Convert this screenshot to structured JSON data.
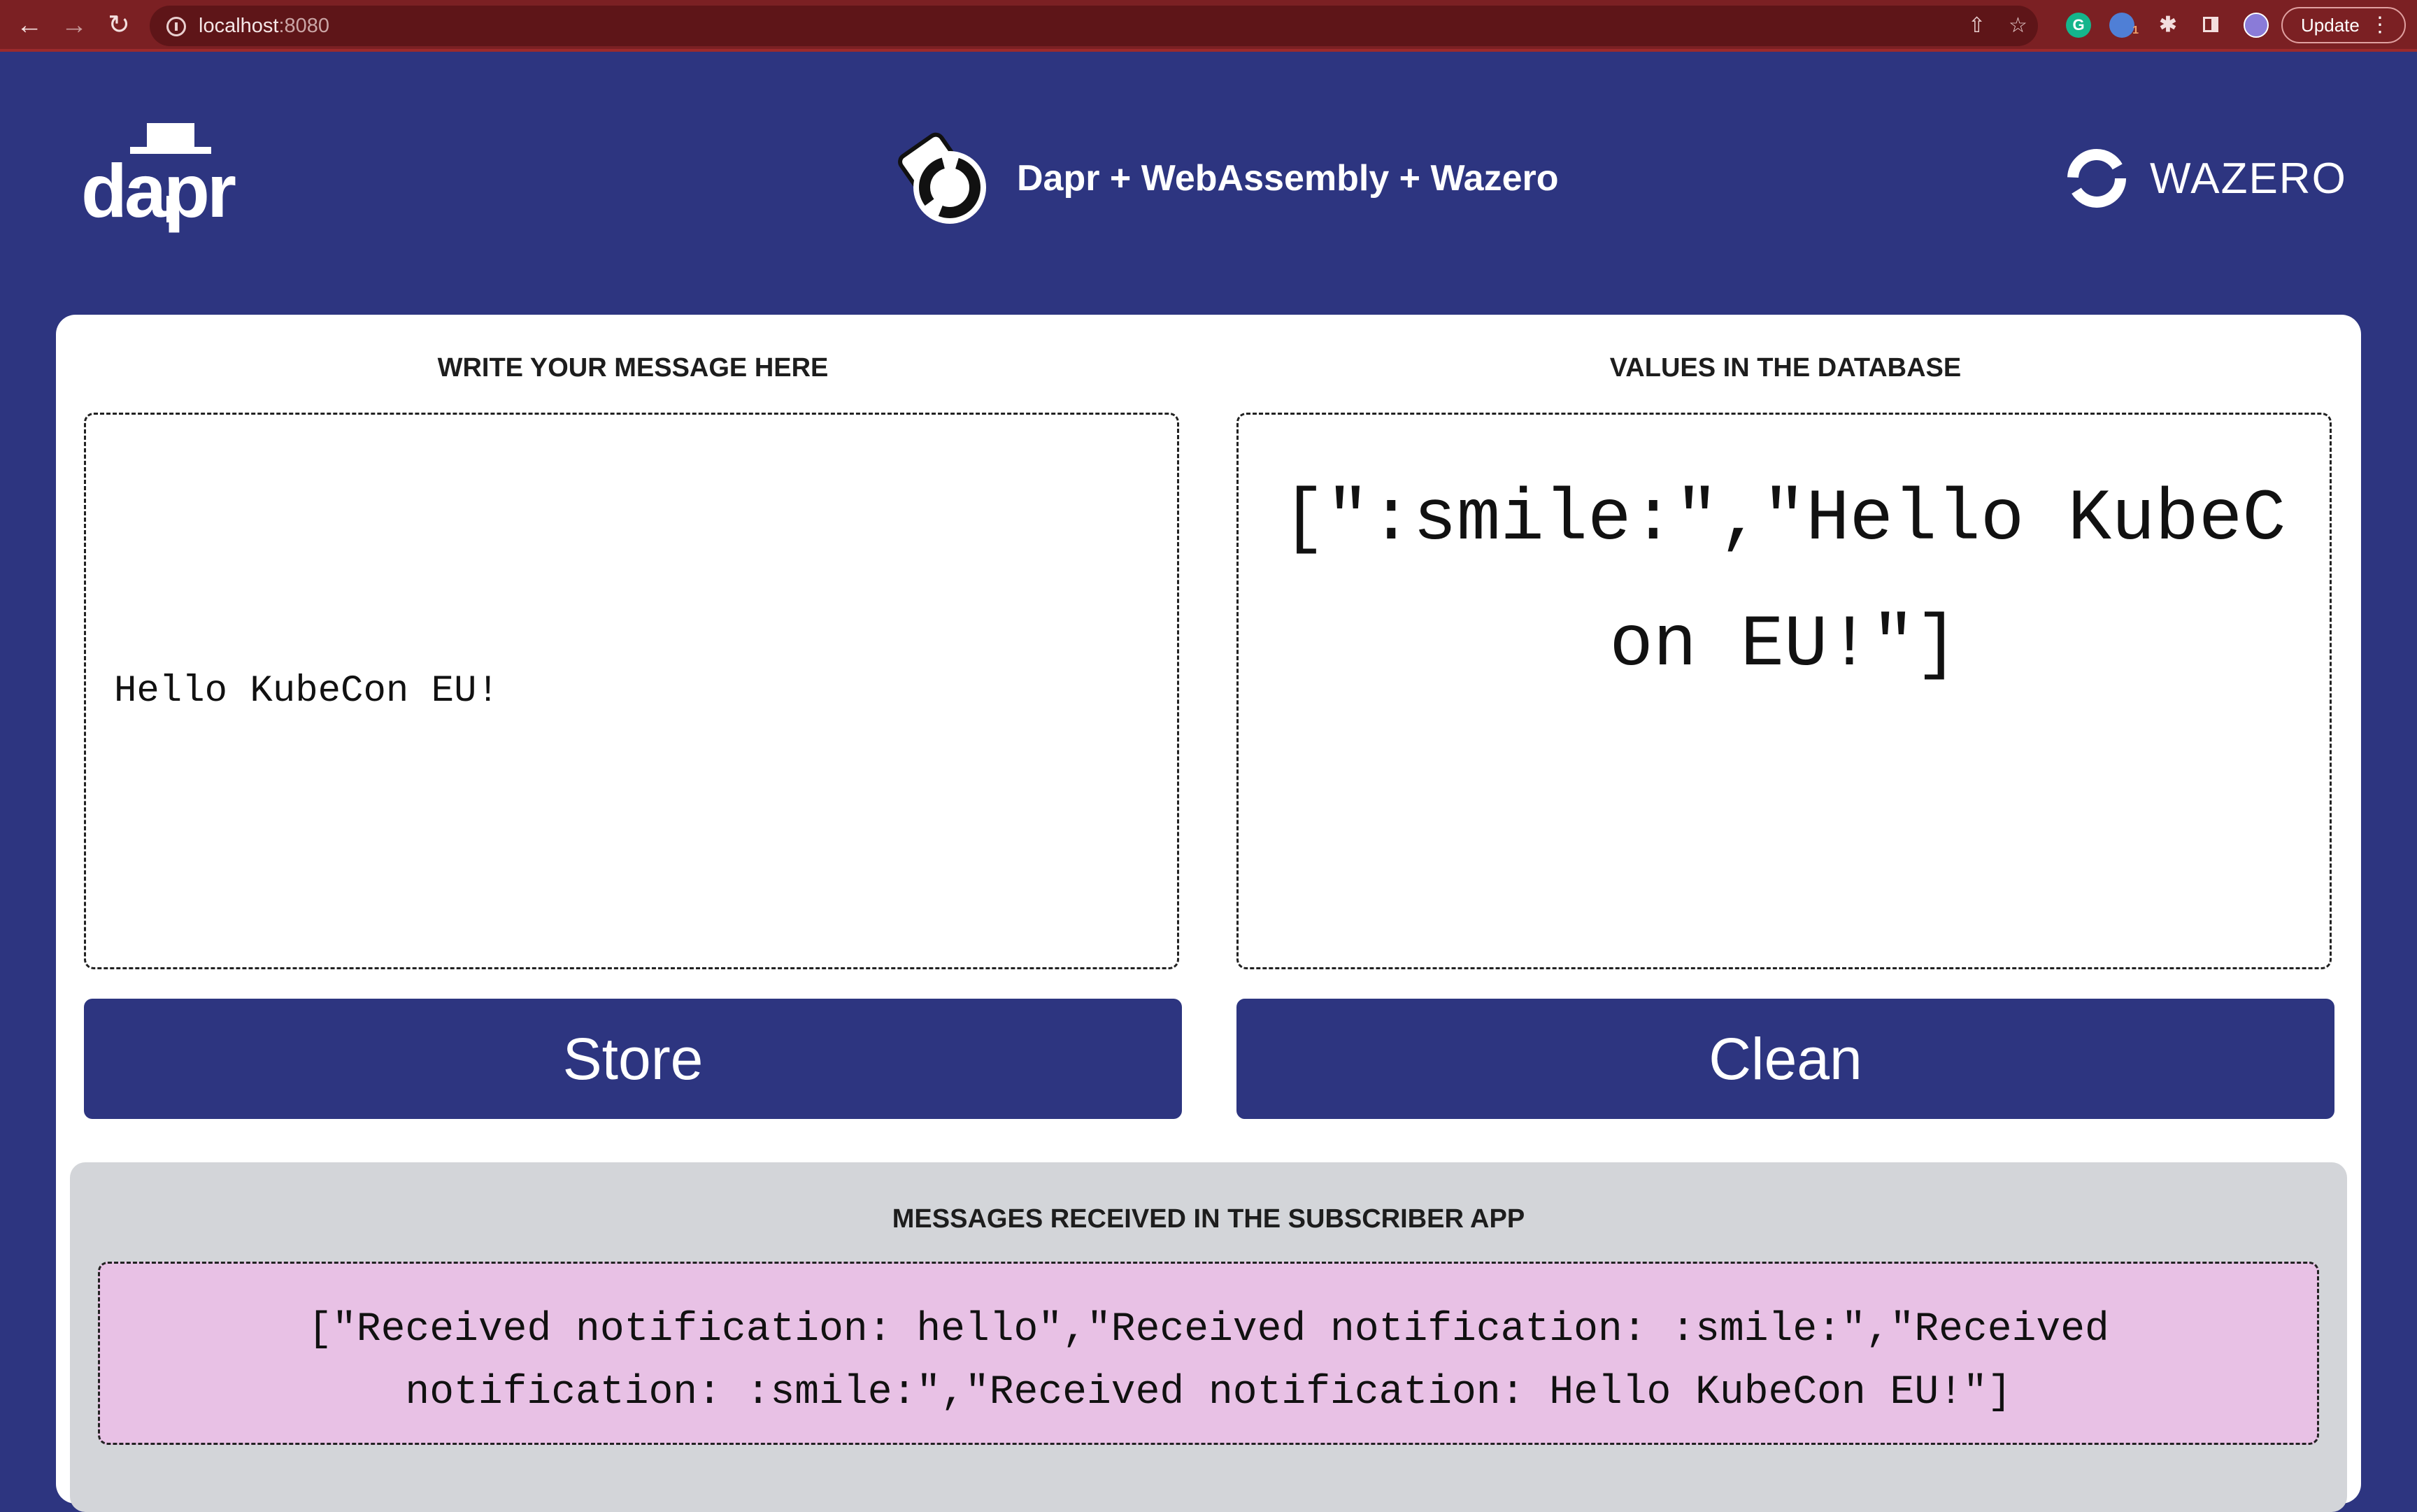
{
  "browser": {
    "url_host": "localhost",
    "url_port": ":8080",
    "update_label": "Update",
    "icons": [
      "back-arrow-icon",
      "forward-arrow-icon",
      "reload-icon",
      "info-icon",
      "share-icon",
      "bookmark-star-icon",
      "grammarly-icon",
      "translate-icon",
      "extensions-puzzle-icon",
      "side-panel-icon",
      "profile-avatar-icon",
      "kebab-menu-icon"
    ],
    "grammarly_letter": "G",
    "translate_badge": "1"
  },
  "header": {
    "dapr_logo_text": "dapr",
    "title": "Dapr + WebAssembly + Wazero",
    "wazero_logo_text": "WAZERO"
  },
  "writer": {
    "title": "WRITE YOUR MESSAGE HERE",
    "value": "Hello KubeCon EU!",
    "button_label": "Store"
  },
  "database": {
    "title": "VALUES IN THE DATABASE",
    "value": "[\":smile:\",\"Hello KubeCon EU!\"]",
    "button_label": "Clean"
  },
  "subscriber": {
    "title": "MESSAGES RECEIVED IN THE SUBSCRIBER APP",
    "value": "[\"Received notification: hello\",\"Received notification: :smile:\",\"Received notification: :smile:\",\"Received notification: Hello KubeCon EU!\"]"
  },
  "colors": {
    "page_background": "#2d3580",
    "browser_bar": "#7b2023",
    "card": "#ffffff",
    "button": "#2d3580",
    "subscriber_panel": "#d3d5d9",
    "subscriber_box": "#e8c1e5"
  }
}
